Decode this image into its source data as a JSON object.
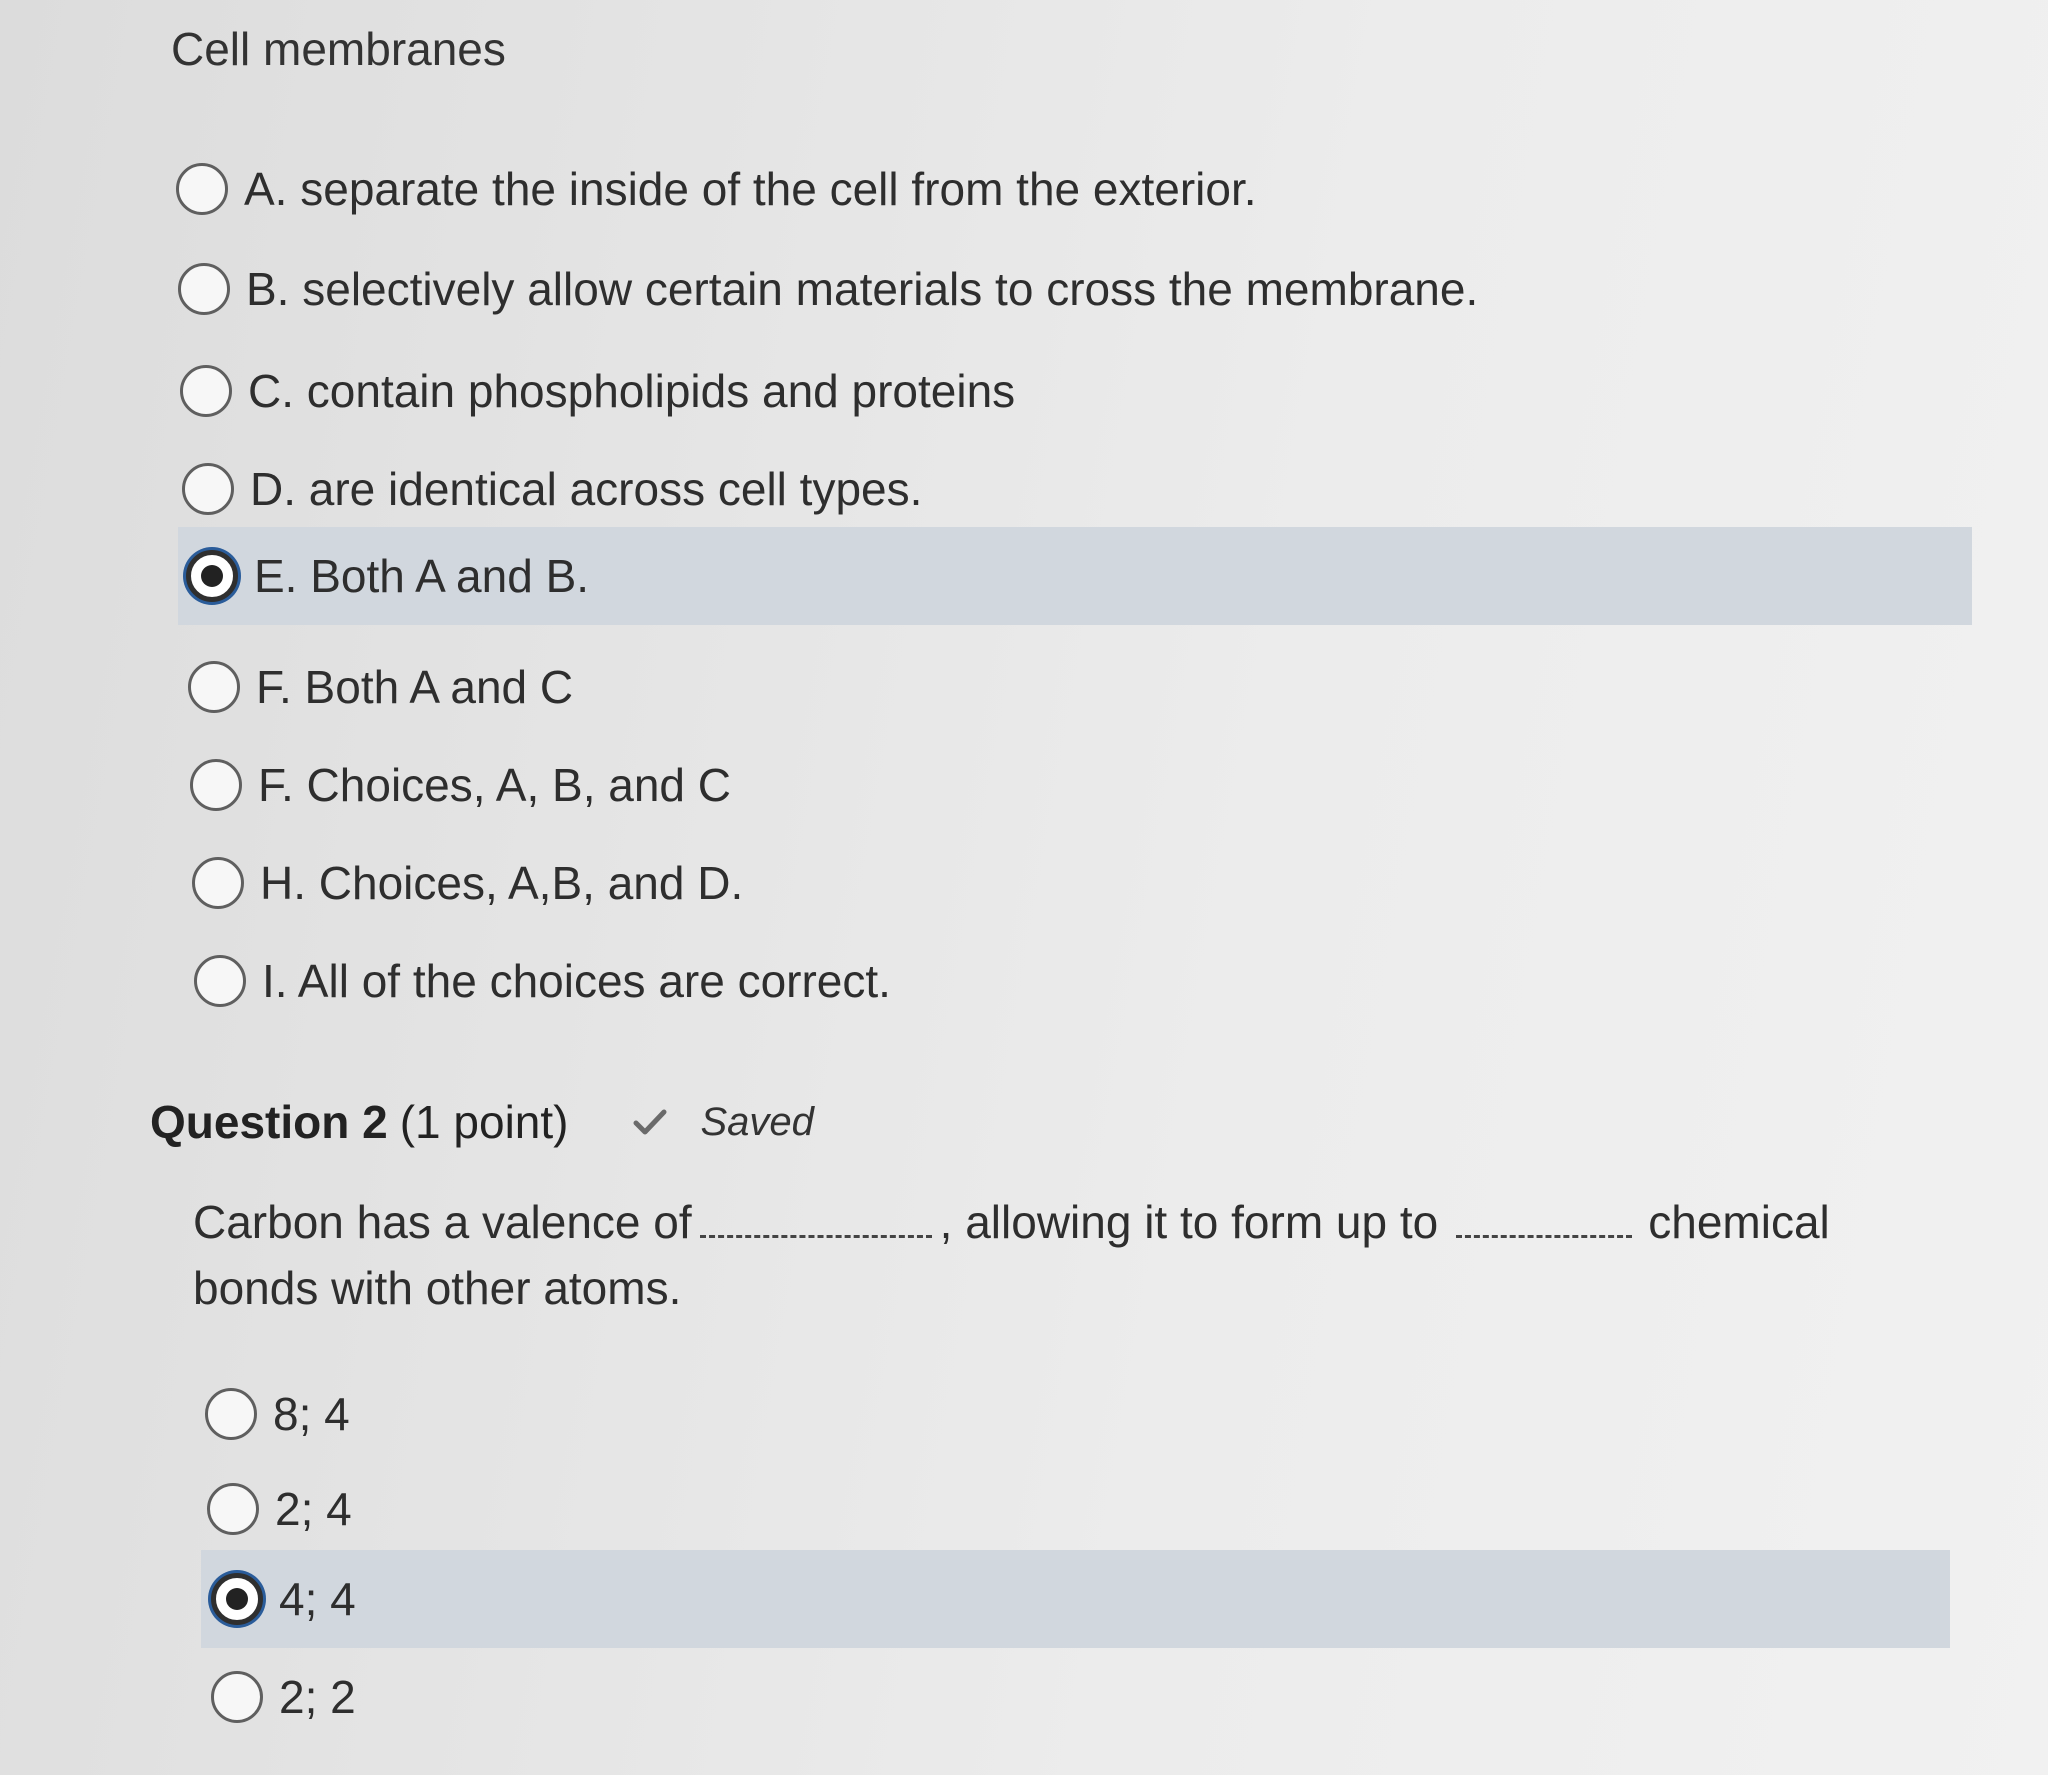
{
  "question1": {
    "prompt": "Cell membranes",
    "options": [
      {
        "label": "A. separate the inside of the cell from the exterior.",
        "selected": false
      },
      {
        "label": "B. selectively allow certain materials to cross the membrane.",
        "selected": false
      },
      {
        "label": "C. contain phospholipids and proteins",
        "selected": false
      },
      {
        "label": "D. are identical across cell types.",
        "selected": false
      },
      {
        "label": "E. Both A and B.",
        "selected": true
      },
      {
        "label": "F. Both A and C",
        "selected": false
      },
      {
        "label": "F. Choices, A, B, and C",
        "selected": false
      },
      {
        "label": "H. Choices, A,B, and D.",
        "selected": false
      },
      {
        "label": "I. All of the choices are correct.",
        "selected": false
      }
    ]
  },
  "question2": {
    "title": "Question 2",
    "points": "(1 point)",
    "status_icon": "checkmark-icon",
    "status": "Saved",
    "stem_part1": "Carbon has a valence of",
    "stem_part2": ", allowing it to form up to",
    "stem_part3": "chemical",
    "stem_part4": "bonds with other atoms.",
    "options": [
      {
        "label": "8; 4",
        "selected": false
      },
      {
        "label": "2; 4",
        "selected": false
      },
      {
        "label": "4; 4",
        "selected": true
      },
      {
        "label": "2; 2",
        "selected": false
      }
    ]
  },
  "colors": {
    "selected_row_bg": "#d1d7de",
    "focus_ring": "#2a5c9a"
  }
}
